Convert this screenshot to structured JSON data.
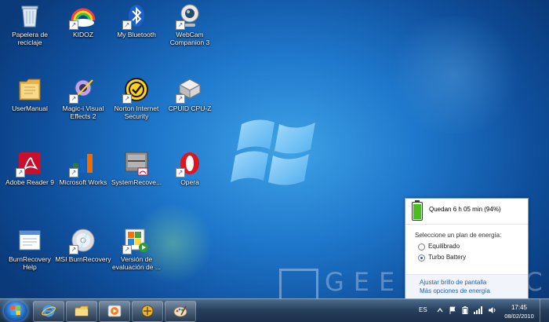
{
  "desktop_icons": [
    {
      "label": "Papelera de reciclaje",
      "icon": "recycle-bin-icon",
      "shortcut": false
    },
    {
      "label": "KIDOZ",
      "icon": "kidoz-icon",
      "shortcut": true
    },
    {
      "label": "My Bluetooth",
      "icon": "bluetooth-icon",
      "shortcut": true
    },
    {
      "label": "WebCam Companion 3",
      "icon": "webcam-icon",
      "shortcut": true
    },
    {
      "label": "UserManual",
      "icon": "folder-icon",
      "shortcut": false
    },
    {
      "label": "Magic-i Visual Effects 2",
      "icon": "magic-webcam-icon",
      "shortcut": true
    },
    {
      "label": "Norton Internet Security",
      "icon": "norton-icon",
      "shortcut": true
    },
    {
      "label": "CPUID CPU-Z",
      "icon": "cpuz-icon",
      "shortcut": true
    },
    {
      "label": "Adobe Reader 9",
      "icon": "adobe-reader-icon",
      "shortcut": true
    },
    {
      "label": "Microsoft Works",
      "icon": "works-icon",
      "shortcut": true
    },
    {
      "label": "SystemRecove...",
      "icon": "system-recovery-icon",
      "shortcut": false
    },
    {
      "label": "Opera",
      "icon": "opera-icon",
      "shortcut": true
    },
    {
      "label": "BurnRecovery Help",
      "icon": "window-doc-icon",
      "shortcut": false
    },
    {
      "label": "MSI BurnRecovery",
      "icon": "disc-icon",
      "shortcut": true
    },
    {
      "label": "Versión de evaluación de ...",
      "icon": "office-trial-icon",
      "shortcut": true
    }
  ],
  "battery_popup": {
    "remaining": "Quedan 6 h 05 min (94%)",
    "charge_percent": 94,
    "plan_title": "Seleccione un plan de energía:",
    "plans": [
      {
        "label": "Equilibrado",
        "selected": false
      },
      {
        "label": "Turbo Battery",
        "selected": true
      }
    ],
    "link_brightness": "Ajustar brillo de pantalla",
    "link_more": "Más opciones de energía"
  },
  "watermark": {
    "text": "GEEKNETIC"
  },
  "taskbar": {
    "buttons": [
      {
        "name": "taskbar-internet-explorer",
        "icon": "ie-icon"
      },
      {
        "name": "taskbar-explorer",
        "icon": "folder-icon"
      },
      {
        "name": "taskbar-media-player",
        "icon": "media-player-icon"
      },
      {
        "name": "taskbar-app",
        "icon": "app-icon"
      },
      {
        "name": "taskbar-paint",
        "icon": "paint-icon"
      }
    ],
    "tray": {
      "language": "ES",
      "time": "17:45",
      "date": "08/02/2010"
    }
  },
  "colors": {
    "desktop_center": "#3fa3e6",
    "desktop_edge": "#0a3a7a",
    "link": "#1e5cbf",
    "battery_fill": "#4cbc23"
  }
}
